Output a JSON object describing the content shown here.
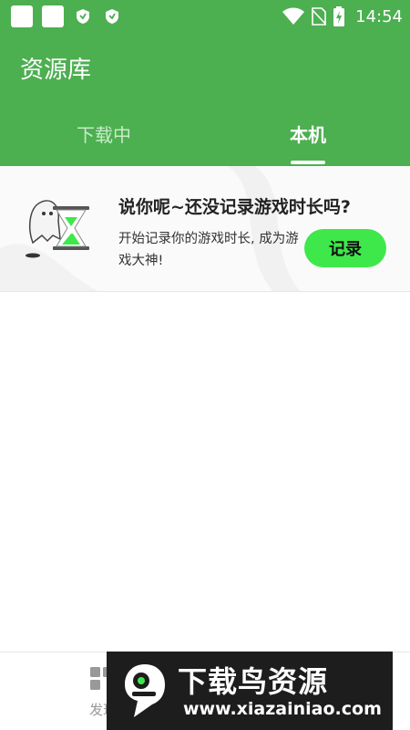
{
  "status_bar": {
    "time": "14:54",
    "icons": [
      "app-square-icon",
      "app-square-icon",
      "shield-icon",
      "shield-icon",
      "wifi-icon",
      "no-sim-icon",
      "battery-charging-icon"
    ]
  },
  "header": {
    "title": "资源库",
    "tabs": [
      {
        "label": "下载中",
        "active": false
      },
      {
        "label": "本机",
        "active": true
      }
    ]
  },
  "empty_card": {
    "title": "说你呢~还没记录游戏时长吗?",
    "description": "开始记录你的游戏时长, 成为游戏大神!",
    "button_label": "记录",
    "illustration": "ghost-hourglass-icon"
  },
  "bottom_nav": {
    "items": [
      {
        "label": "发现",
        "icon": "grid-icon"
      }
    ]
  },
  "watermark": {
    "title": "下载鸟资源",
    "url": "www.xiazainiao.com",
    "logo": "bird-logo-icon"
  },
  "colors": {
    "primary": "#4caf50",
    "button": "#3fe84a",
    "watermark_bg": "#1d1d1d"
  }
}
